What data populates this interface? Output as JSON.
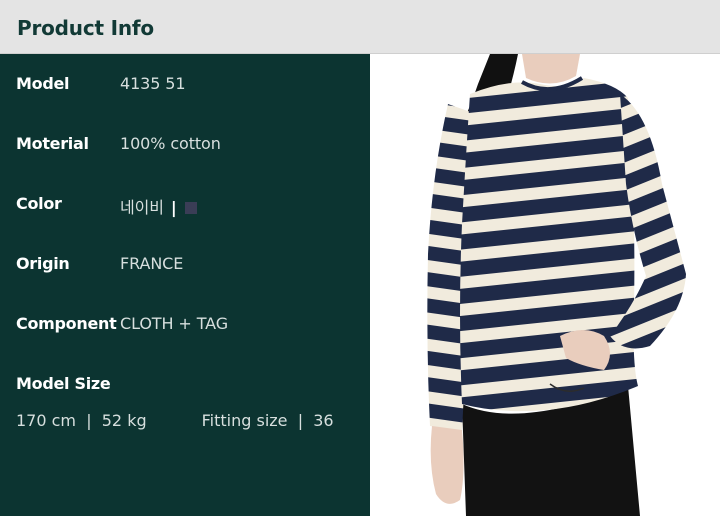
{
  "header": {
    "title": "Product Info"
  },
  "rows": [
    {
      "label": "Model",
      "value": "4135 51"
    },
    {
      "label": "Moterial",
      "value": "100% cotton"
    },
    {
      "label": "Color",
      "value": "네이비",
      "separator": "|",
      "swatch_color": "#3a3d56"
    },
    {
      "label": "Origin",
      "value": "FRANCE"
    },
    {
      "label": "Component",
      "value": "CLOTH + TAG"
    }
  ],
  "model_size": {
    "label": "Model Size",
    "height": "170 cm",
    "sep1": "|",
    "weight": "52 kg",
    "fitting_label": "Fitting size",
    "sep2": "|",
    "fitting_value": "36"
  },
  "colors": {
    "panel_bg": "#0c3431",
    "header_bg": "#e4e4e4",
    "stripe_navy": "#1f2a48",
    "stripe_cream": "#f1ebdd"
  },
  "photo": {
    "icon": "model-photo"
  }
}
